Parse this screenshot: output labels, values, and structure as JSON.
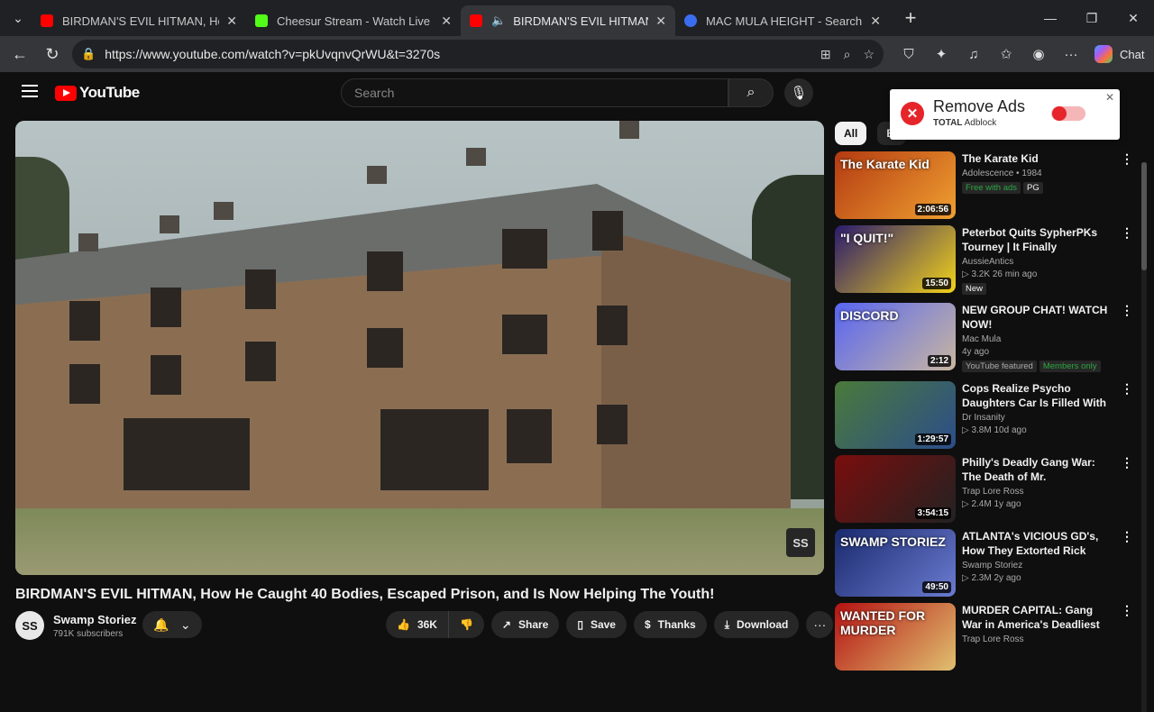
{
  "browser": {
    "tabs": [
      {
        "title": "BIRDMAN'S EVIL HITMAN, How He Caught",
        "active": false,
        "favicon_color": "#ff0000"
      },
      {
        "title": "Cheesur Stream - Watch Live on Kick",
        "active": false,
        "favicon_color": "#53fc18"
      },
      {
        "title": "BIRDMAN'S EVIL HITMAN, He Caught",
        "active": true,
        "favicon_color": "#ff0000"
      },
      {
        "title": "MAC MULA HEIGHT - Search",
        "active": false,
        "favicon_color": "#3a6df0"
      }
    ],
    "url": "https://www.youtube.com/watch?v=pkUvqnvQrWU&t=3270s",
    "chat_label": "Chat"
  },
  "youtube": {
    "logo_text": "YouTube",
    "search_placeholder": "Search",
    "video_title": "BIRDMAN'S EVIL HITMAN, How He Caught 40 Bodies, Escaped Prison, and Is Now Helping The Youth!",
    "watermark": "SS",
    "channel": {
      "name": "Swamp Storiez",
      "subscribers": "791K subscribers",
      "avatar_text": "SS"
    },
    "actions": {
      "likes": "36K",
      "share": "Share",
      "save": "Save",
      "thanks": "Thanks",
      "download": "Download"
    },
    "chips": [
      "All",
      "Bi"
    ]
  },
  "recommendations": [
    {
      "title": "The Karate Kid",
      "line1": "Adolescence • 1984",
      "badges": [
        "Free with ads",
        "PG"
      ],
      "duration": "2:06:56",
      "thumb_text": "The Karate Kid",
      "colors": [
        "#b33a12",
        "#f0a030"
      ]
    },
    {
      "title": "Peterbot Quits SypherPKs Tourney | It Finally Happened...",
      "line1": "AussieAntics",
      "line2": "▷ 3.2K  26 min ago",
      "badges": [
        "New"
      ],
      "duration": "15:50",
      "thumb_text": "\"I QUIT!\"",
      "colors": [
        "#2a1b6e",
        "#f2d21b"
      ]
    },
    {
      "title": "NEW GROUP CHAT!  WATCH NOW!",
      "line1": "Mac Mula",
      "line2": "4y ago",
      "badges": [
        "YouTube featured",
        "Members only"
      ],
      "duration": "2:12",
      "thumb_text": "DISCORD",
      "colors": [
        "#5865f2",
        "#c8b7a0"
      ]
    },
    {
      "title": "Cops Realize Psycho Daughters Car Is Filled With Bodies",
      "line1": "Dr Insanity",
      "line2": "▷ 3.8M  10d ago",
      "badges": [],
      "duration": "1:29:57",
      "thumb_text": "",
      "colors": [
        "#4a7a3a",
        "#2c4d8a"
      ]
    },
    {
      "title": "Philly's Deadly Gang War: The Death of Mr. Disrespectful",
      "line1": "Trap Lore Ross",
      "line2": "▷ 2.4M  1y ago",
      "badges": [],
      "duration": "3:54:15",
      "thumb_text": "",
      "colors": [
        "#7a0d0d",
        "#222222"
      ]
    },
    {
      "title": "ATLANTA's VICIOUS GD's, How They Extorted Rick Ross for ...",
      "line1": "Swamp Storiez",
      "line2": "▷ 2.3M  2y ago",
      "badges": [],
      "duration": "49:50",
      "thumb_text": "SWAMP STORIEZ",
      "colors": [
        "#1a2a6e",
        "#6b7bd0"
      ]
    },
    {
      "title": "MURDER CAPITAL: Gang War in America's Deadliest City",
      "line1": "Trap Lore Ross",
      "line2": "",
      "badges": [],
      "duration": "",
      "thumb_text": "WANTED FOR MURDER",
      "colors": [
        "#b51212",
        "#e0c070"
      ]
    }
  ],
  "adblock": {
    "heading": "Remove Ads",
    "brand": "TOTAL",
    "product": "Adblock"
  }
}
